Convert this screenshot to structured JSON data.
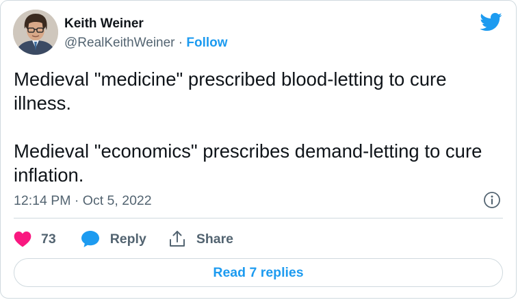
{
  "author": {
    "name": "Keith Weiner",
    "handle": "@RealKeithWeiner",
    "separator": "·",
    "follow_label": "Follow"
  },
  "tweet": {
    "paragraphs": [
      "Medieval \"medicine\" prescribed blood-letting to cure illness.",
      "Medieval \"economics\" prescribes demand-letting to cure inflation."
    ],
    "timestamp": "12:14 PM · Oct 5, 2022"
  },
  "actions": {
    "like_count": "73",
    "reply_label": "Reply",
    "share_label": "Share",
    "read_replies_label": "Read 7 replies"
  },
  "icons": {
    "brand": "twitter-bird-icon",
    "info": "info-icon",
    "like": "heart-icon",
    "reply": "speech-bubble-icon",
    "share": "share-icon"
  },
  "colors": {
    "accent": "#1d9bf0",
    "like": "#f91880",
    "text_primary": "#0f1419",
    "text_secondary": "#536471",
    "border": "#cfd9de"
  }
}
